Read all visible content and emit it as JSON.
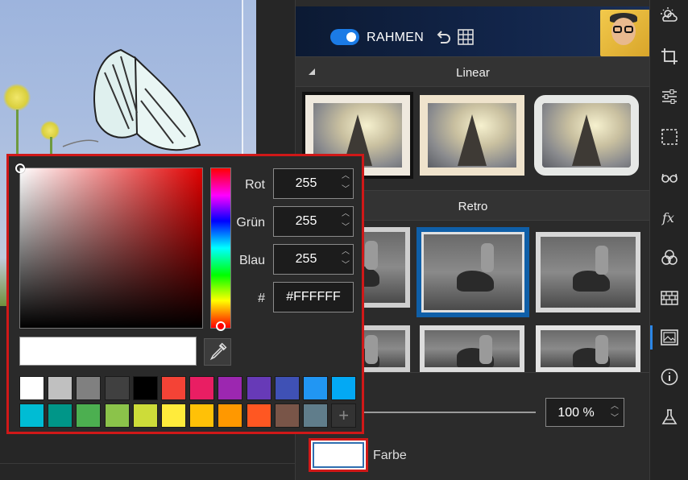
{
  "frame_panel": {
    "toggle_on": true,
    "title": "RAHMEN",
    "undo_icon": "undo-icon",
    "grid_icon": "grid-icon"
  },
  "sections": [
    {
      "label": "Linear"
    },
    {
      "label": "Retro"
    }
  ],
  "opacity": {
    "value": "100 %"
  },
  "color_swatch": {
    "label": "Farbe",
    "color": "#FFFFFF"
  },
  "picker": {
    "fields": [
      {
        "label": "Rot",
        "value": "255"
      },
      {
        "label": "Grün",
        "value": "255"
      },
      {
        "label": "Blau",
        "value": "255"
      },
      {
        "label": "#",
        "value": "#FFFFFF"
      }
    ],
    "current_color": "#FFFFFF",
    "palette": [
      "#FFFFFF",
      "#C0C0C0",
      "#808080",
      "#404040",
      "#000000",
      "#F44336",
      "#E91E63",
      "#9C27B0",
      "#673AB7",
      "#3F51B5",
      "#2196F3",
      "#03A9F4",
      "#00BCD4",
      "#009688",
      "#4CAF50",
      "#8BC34A",
      "#CDDC39",
      "#FFEB3B",
      "#FFC107",
      "#FF9800",
      "#FF5722",
      "#795548",
      "#607D8B"
    ],
    "add_label": "+"
  },
  "rail_icons": [
    "weather-icon",
    "crop-icon",
    "adjust-sliders-icon",
    "selection-icon",
    "glasses-icon",
    "fx-icon",
    "color-circles-icon",
    "texture-grid-icon",
    "image-frame-icon",
    "info-icon",
    "lab-flask-icon"
  ],
  "colors": {
    "accent": "#2C86E6",
    "highlight": "#D01818"
  }
}
